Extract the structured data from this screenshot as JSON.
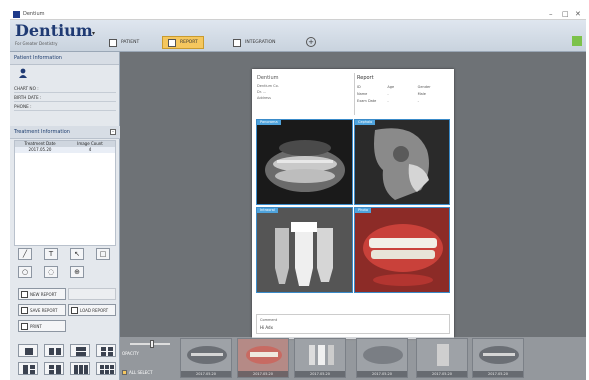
{
  "window": {
    "title": "Dentium"
  },
  "brand": {
    "name": "Dentium",
    "tagline": "For Greater Dentistry"
  },
  "nav_tabs": [
    {
      "label": "PATIENT"
    },
    {
      "label": "REPORT"
    },
    {
      "label": "INTEGRATION"
    }
  ],
  "patient": {
    "section_title": "Patient Information",
    "fields": [
      {
        "label": "CHART NO :"
      },
      {
        "label": "BIRTH DATE :"
      },
      {
        "label": "PHONE :"
      }
    ]
  },
  "treatment": {
    "section_title": "Treatment Information",
    "columns": [
      "Treatment Date",
      "Image Count"
    ],
    "rows": [
      {
        "date": "2017.05.20",
        "count": "4"
      }
    ]
  },
  "tools": {
    "new_report": "NEW REPORT",
    "save_report": "SAVE REPORT",
    "load_report": "LOAD REPORT",
    "print": "PRINT"
  },
  "report": {
    "logo": "Dentium",
    "lines": [
      "Dentium Co.",
      "Dr. ...",
      "Address"
    ],
    "info_title": "Report",
    "info_rows": [
      [
        "ID",
        "Age",
        "Gender"
      ],
      [
        "Name",
        "-",
        "Male"
      ],
      [
        "Exam Date",
        "-",
        "-"
      ]
    ],
    "images": [
      {
        "label": "Panorama"
      },
      {
        "label": "Cephalo"
      },
      {
        "label": "Intraoral"
      },
      {
        "label": "Photo"
      }
    ],
    "footer_key": "Comment",
    "footer_value": "Hi Adx"
  },
  "bottom": {
    "opacity_label": "OPACITY",
    "select_all": "ALL SELECT",
    "thumb_caption": "2017.05.20"
  },
  "colors": {
    "accent": "#f5c75e",
    "label_blue": "#4fa3dc",
    "brand_blue": "#1f3a73"
  }
}
